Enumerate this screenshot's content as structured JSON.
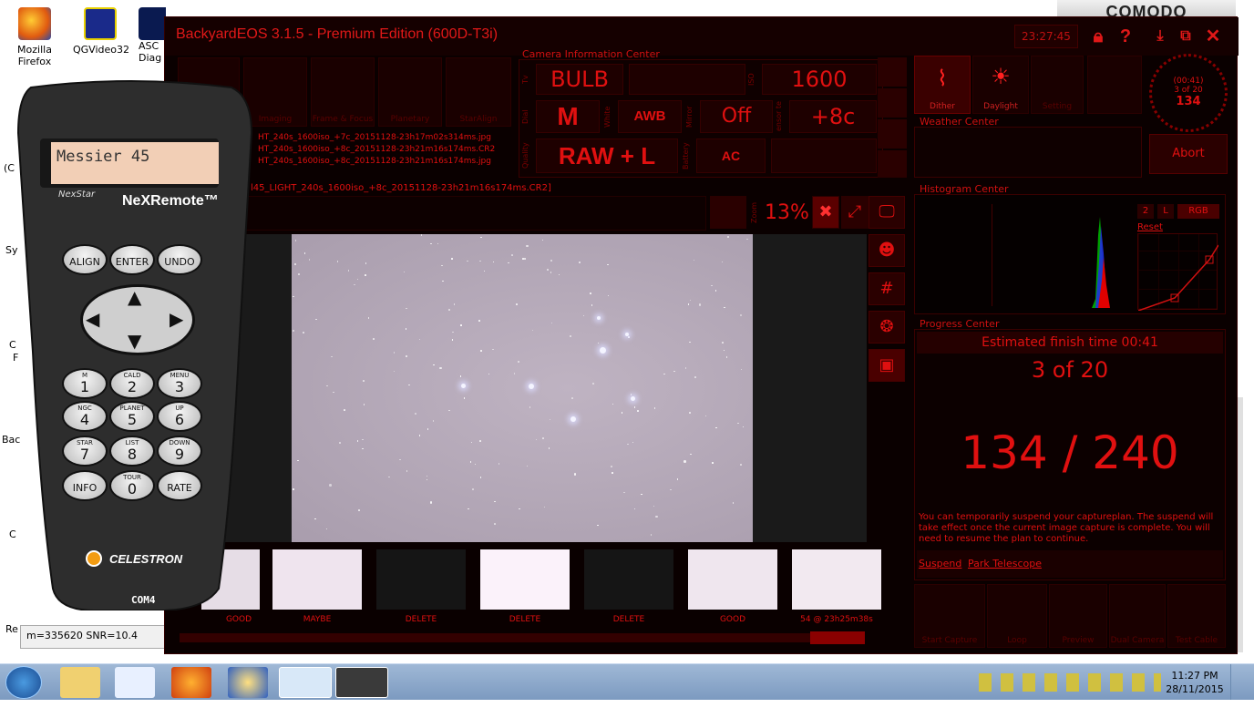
{
  "desktop": {
    "icons": [
      {
        "label1": "Mozilla",
        "label2": "Firefox"
      },
      {
        "label1": "QGVideo32",
        "label2": ""
      },
      {
        "label1": "ASC",
        "label2": "Diag"
      }
    ],
    "left_fragments": [
      "(C",
      "Sy",
      "C",
      "F",
      "Bac",
      "C",
      "Re"
    ],
    "comodo": "COMODO",
    "status_line": "m=335620 SNR=10.4"
  },
  "app": {
    "title": "BackyardEOS 3.1.5 - Premium Edition (600D-T3i)",
    "clock": "23:27:45",
    "mode_tiles": [
      "Imaging",
      "Frame & Focus",
      "Planetary",
      "StarAlign"
    ],
    "log_lines": [
      "HT_240s_1600iso_+7c_20151128-23h17m02s314ms.jpg",
      "HT_240s_1600iso_+8c_20151128-23h21m16s174ms.CR2",
      "HT_240s_1600iso_+8c_20151128-23h21m16s174ms.jpg"
    ],
    "current_file": "l45_LIGHT_240s_1600iso_+8c_20151128-23h21m16s174ms.CR2]",
    "camera_info": {
      "title": "Camera Information Center",
      "tv_label": "Tv",
      "shutter": "BULB",
      "iso_label": "ISO",
      "iso": "1600",
      "dial_label": "Dial",
      "mode": "M",
      "white_label": "White",
      "wb": "AWB",
      "mirror_label": "Mirror",
      "mirror": "Off",
      "sensor_label": "ensor te",
      "temp": "+8c",
      "quality_label": "Quality",
      "quality": "RAW + L",
      "battery_label": "Battery",
      "battery": "AC"
    },
    "top_right": {
      "dither": "Dither",
      "daylight": "Daylight",
      "setting": "Setting",
      "progress_small": "(00:41)",
      "progress_count": "3 of 20",
      "progress_value": "134"
    },
    "weather_title": "Weather Center",
    "abort": "Abort",
    "zoom_label": "Zoom",
    "zoom": "13%",
    "histogram": {
      "title": "Histogram Center",
      "buttons": [
        "2",
        "L",
        "RGB"
      ],
      "reset": "Reset"
    },
    "progress": {
      "title": "Progress Center",
      "estimated": "Estimated finish time 00:41",
      "count": "3 of 20",
      "seconds": "134 / 240",
      "message": "You can temporarily suspend your captureplan. The suspend will take effect once the current image capture is complete. You will need to resume the plan to continue.",
      "suspend": "Suspend",
      "park": "Park Telescope"
    },
    "thumbnails": [
      {
        "label": "GOOD",
        "tone": "#e6dde6"
      },
      {
        "label": "MAYBE",
        "tone": "#efe4ee"
      },
      {
        "label": "DELETE",
        "tone": "#151515"
      },
      {
        "label": "DELETE",
        "tone": "#fbf2fa"
      },
      {
        "label": "DELETE",
        "tone": "#151515"
      },
      {
        "label": "GOOD",
        "tone": "#efe6ee"
      },
      {
        "label": "54 @ 23h25m38s",
        "tone": "#f2e9f0"
      }
    ],
    "bottom_buttons": [
      "Start Capture",
      "Loop",
      "Preview",
      "Dual Camera",
      "Test Cable"
    ]
  },
  "remote": {
    "display": "Messier 45",
    "brand_left": "NexStar",
    "brand_right": "NeXRemote™",
    "keys": [
      {
        "top": "",
        "main": "ALIGN"
      },
      {
        "top": "",
        "main": "ENTER"
      },
      {
        "top": "",
        "main": "UNDO"
      },
      {
        "top": "M",
        "main": "1"
      },
      {
        "top": "CALD",
        "main": "2"
      },
      {
        "top": "MENU",
        "main": "3"
      },
      {
        "top": "NGC",
        "main": "4"
      },
      {
        "top": "PLANET",
        "main": "5"
      },
      {
        "top": "UP",
        "main": "6"
      },
      {
        "top": "STAR",
        "main": "7"
      },
      {
        "top": "LIST",
        "main": "8"
      },
      {
        "top": "DOWN",
        "main": "9"
      },
      {
        "top": "",
        "main": "INFO"
      },
      {
        "top": "TOUR",
        "main": "0"
      },
      {
        "top": "",
        "main": "RATE"
      }
    ],
    "maker": "CELESTRON",
    "port": "COM4"
  },
  "taskbar": {
    "time": "11:27 PM",
    "date": "28/11/2015"
  }
}
